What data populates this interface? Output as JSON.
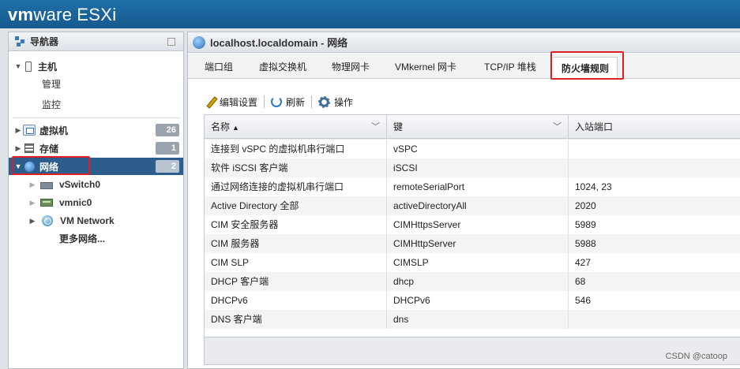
{
  "brand": {
    "vm": "vm",
    "ware": "ware",
    "esxi": "ESXi"
  },
  "navigator": {
    "title": "导航器",
    "host": {
      "label": "主机",
      "children": [
        "管理",
        "监控"
      ]
    },
    "items": [
      {
        "label": "虚拟机",
        "count": "26"
      },
      {
        "label": "存储",
        "count": "1"
      },
      {
        "label": "网络",
        "count": "2",
        "selected": true
      }
    ],
    "network_children": [
      {
        "label": "vSwitch0",
        "icon": "switch-icon"
      },
      {
        "label": "vmnic0",
        "icon": "nic-icon"
      },
      {
        "label": "VM Network",
        "icon": "vm-network-icon"
      },
      {
        "label": "更多网络...",
        "icon": ""
      }
    ]
  },
  "main": {
    "title": "localhost.localdomain - 网络",
    "tabs": [
      "端口组",
      "虚拟交换机",
      "物理网卡",
      "VMkernel 网卡",
      "TCP/IP 堆栈",
      "防火墙规则"
    ],
    "active_tab": "防火墙规则",
    "toolbar": {
      "edit": "编辑设置",
      "refresh": "刷新",
      "actions": "操作"
    },
    "table": {
      "columns": [
        "名称",
        "键",
        "入站端口"
      ],
      "sort_indicator": "▲",
      "rows": [
        [
          "连接到 vSPC 的虚拟机串行端口",
          "vSPC",
          ""
        ],
        [
          "软件 iSCSI 客户端",
          "iSCSI",
          ""
        ],
        [
          "通过网络连接的虚拟机串行端口",
          "remoteSerialPort",
          "1024, 23"
        ],
        [
          "Active Directory 全部",
          "activeDirectoryAll",
          "2020"
        ],
        [
          "CIM 安全服务器",
          "CIMHttpsServer",
          "5989"
        ],
        [
          "CIM 服务器",
          "CIMHttpServer",
          "5988"
        ],
        [
          "CIM SLP",
          "CIMSLP",
          "427"
        ],
        [
          "DHCP 客户端",
          "dhcp",
          "68"
        ],
        [
          "DHCPv6",
          "DHCPv6",
          "546"
        ],
        [
          "DNS 客户端",
          "dns",
          ""
        ]
      ]
    }
  },
  "watermark": "CSDN @catoop",
  "colors": {
    "accent": "#1f6fa8",
    "selected": "#2c5d8c",
    "highlight": "#e02020"
  }
}
